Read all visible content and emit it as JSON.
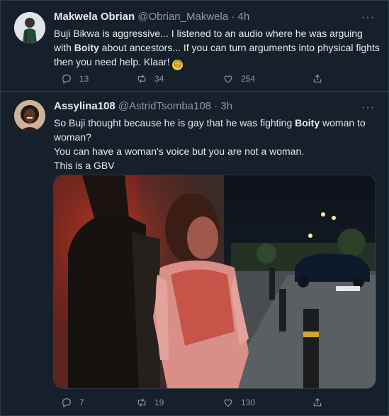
{
  "tweets": [
    {
      "name": "Makwela Obrian",
      "handle": "@Obrian_Makwela",
      "time": "· 4h",
      "text_parts": [
        "Buji Bikwa is aggressive... I listened to an audio where he was arguing with ",
        "Boity",
        " about ancestors... If you can turn arguments into physical fights then you need help. Klaar! "
      ],
      "emoji": "😩",
      "replies": "13",
      "retweets": "34",
      "likes": "254"
    },
    {
      "name": "Assylina108",
      "handle": "@AstridTsomba108",
      "time": "· 3h",
      "line1_parts": [
        "So Buji thought because he is gay that he was fighting ",
        "Boity",
        " woman to woman?"
      ],
      "line2": "You can have a woman's voice but you are not a woman.",
      "line3": "This is a GBV",
      "replies": "7",
      "retweets": "19",
      "likes": "130"
    }
  ],
  "more_label": "···",
  "colors": {
    "bg": "#15202b",
    "text": "#e7e9ea",
    "muted": "#8b98a5",
    "divider": "#38444d"
  }
}
